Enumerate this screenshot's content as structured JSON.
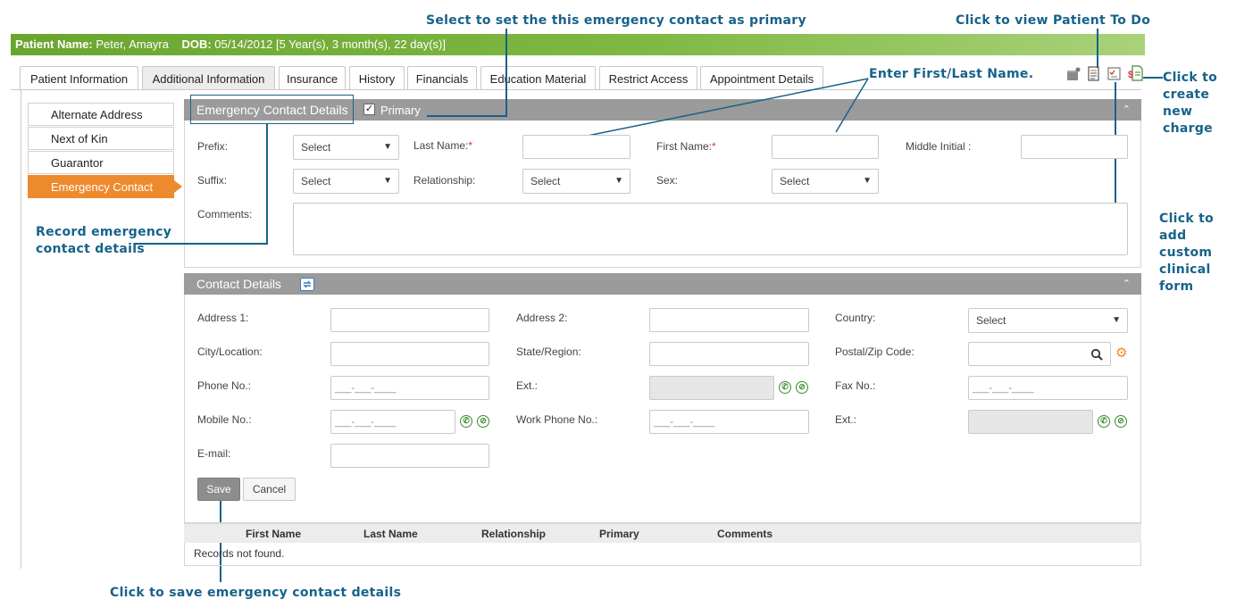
{
  "annotations": {
    "primary": "Select to set the this emergency contact as primary",
    "todo": "Click to view Patient To Do",
    "name": "Enter First/Last Name.",
    "charge": [
      "Click to",
      "create",
      "new",
      "charge"
    ],
    "clinical_form": [
      "Click to",
      "add",
      "custom",
      "clinical",
      "form"
    ],
    "record": [
      "Record emergency",
      "contact details"
    ],
    "save": "Click to save emergency contact details"
  },
  "patient": {
    "name_label": "Patient Name:",
    "name_value": "Peter, Amayra",
    "dob_label": "DOB:",
    "dob_value": "05/14/2012 [5 Year(s), 3 month(s), 22 day(s)]"
  },
  "tabs": [
    {
      "label": "Patient Information"
    },
    {
      "label": "Additional Information"
    },
    {
      "label": "Insurance"
    },
    {
      "label": "History"
    },
    {
      "label": "Financials"
    },
    {
      "label": "Education Material"
    },
    {
      "label": "Restrict Access"
    },
    {
      "label": "Appointment Details"
    }
  ],
  "active_tab": "Additional Information",
  "sidebar": {
    "items": [
      {
        "label": "Alternate Address"
      },
      {
        "label": "Next of Kin"
      },
      {
        "label": "Guarantor"
      },
      {
        "label": "Emergency Contact"
      }
    ],
    "active": "Emergency Contact"
  },
  "emergency": {
    "title": "Emergency Contact Details",
    "primary_label": "Primary",
    "primary_checked": true,
    "prefix_label": "Prefix:",
    "prefix_value": "Select",
    "last_name_label": "Last Name:",
    "first_name_label": "First Name:",
    "middle_initial_label": "Middle Initial :",
    "required_mark": "*",
    "suffix_label": "Suffix:",
    "suffix_value": "Select",
    "relationship_label": "Relationship:",
    "relationship_value": "Select",
    "sex_label": "Sex:",
    "sex_value": "Select",
    "comments_label": "Comments:"
  },
  "contact": {
    "title": "Contact Details",
    "address1_label": "Address 1:",
    "address2_label": "Address 2:",
    "country_label": "Country:",
    "country_value": "Select",
    "city_label": "City/Location:",
    "state_label": "State/Region:",
    "postal_label": "Postal/Zip Code:",
    "phone_label": "Phone No.:",
    "phone_mask": "___-___-____",
    "ext_label": "Ext.:",
    "fax_label": "Fax No.:",
    "fax_mask": "___-___-____",
    "mobile_label": "Mobile No.:",
    "mobile_mask": "___-___-____",
    "work_phone_label": "Work Phone No.:",
    "work_phone_mask": "___-___-____",
    "ext2_label": "Ext.:",
    "email_label": "E-mail:"
  },
  "buttons": {
    "save": "Save",
    "cancel": "Cancel"
  },
  "grid": {
    "columns": [
      "First Name",
      "Last Name",
      "Relationship",
      "Primary",
      "Comments"
    ],
    "empty_message": "Records not found."
  },
  "colors": {
    "accent_orange": "#ee8a2e",
    "patient_bar_green": "#7eb843",
    "annotation_blue": "#17628a",
    "panel_header_gray": "#9b9b9b"
  }
}
